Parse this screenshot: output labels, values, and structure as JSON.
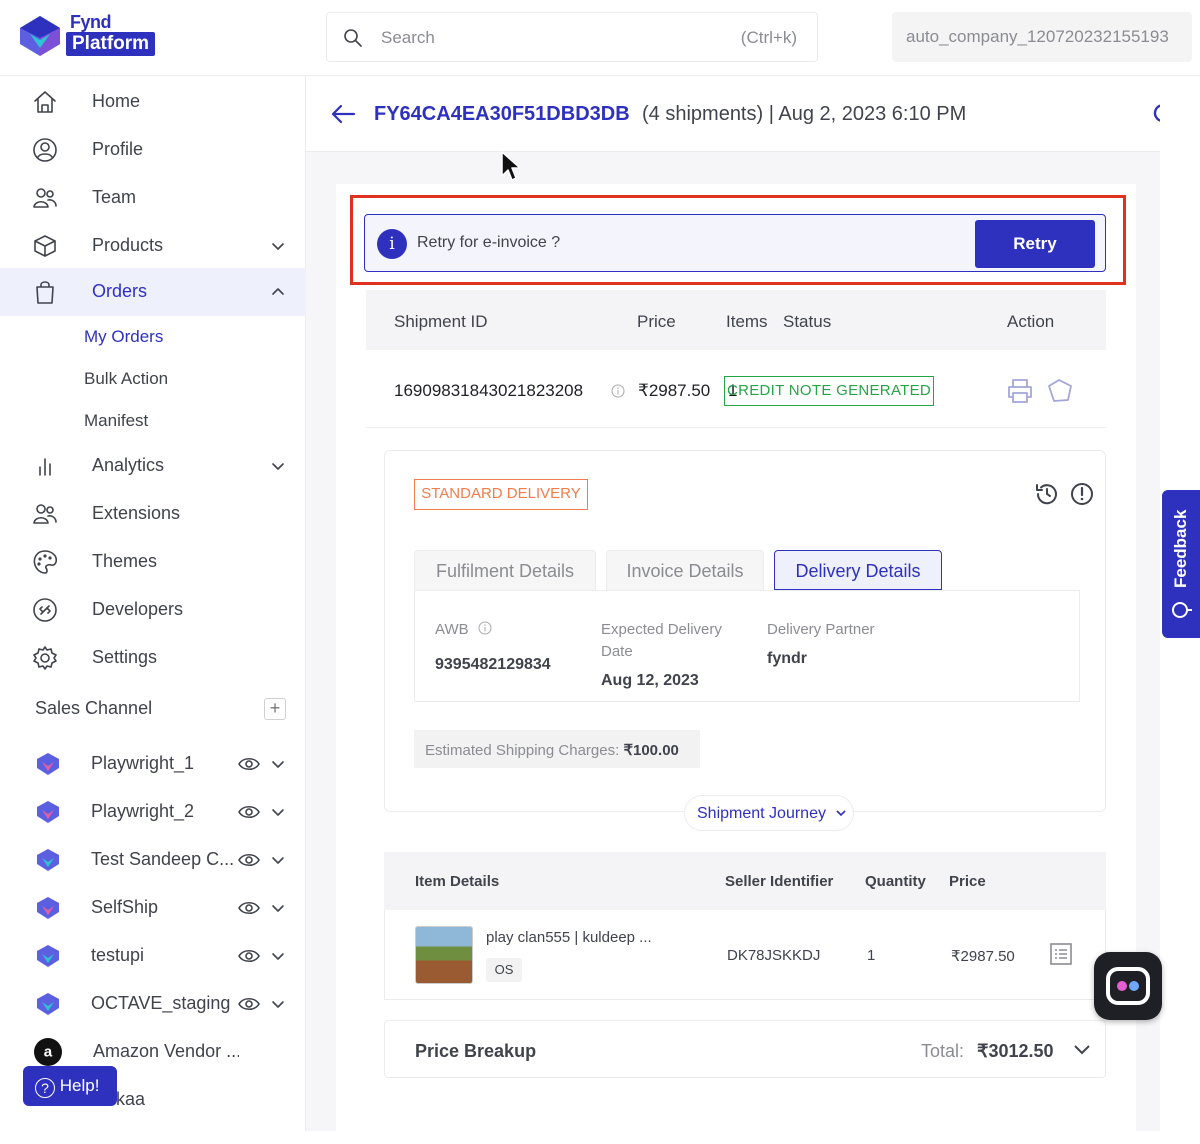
{
  "brand": {
    "line1": "Fynd",
    "line2": "Platform"
  },
  "search": {
    "placeholder": "Search",
    "shortcut": "(Ctrl+k)"
  },
  "company": "auto_company_120720232155193",
  "sidebar": {
    "items": [
      {
        "label": "Home",
        "icon": "home-icon"
      },
      {
        "label": "Profile",
        "icon": "profile-icon"
      },
      {
        "label": "Team",
        "icon": "team-icon"
      },
      {
        "label": "Products",
        "icon": "box-icon"
      },
      {
        "label": "Orders",
        "icon": "bag-icon"
      }
    ],
    "orders_sub": [
      "My Orders",
      "Bulk Action",
      "Manifest"
    ],
    "items2": [
      {
        "label": "Analytics",
        "icon": "analytics-icon"
      },
      {
        "label": "Extensions",
        "icon": "extensions-icon"
      },
      {
        "label": "Themes",
        "icon": "palette-icon"
      },
      {
        "label": "Developers",
        "icon": "developers-icon"
      },
      {
        "label": "Settings",
        "icon": "gear-icon"
      }
    ],
    "sales_channel_title": "Sales Channel",
    "channels": [
      "Playwright_1",
      "Playwright_2",
      "Test Sandeep C...",
      "SelfShip",
      "testupi",
      "OCTAVE_staging",
      "Amazon Vendor ...",
      "kaa"
    ],
    "help": "Help!"
  },
  "header": {
    "order_id": "FY64CA4EA30F51DBD3DB",
    "meta": "(4 shipments) | Aug 2, 2023 6:10 PM"
  },
  "alert": {
    "text": "Retry for e-invoice ?",
    "button": "Retry"
  },
  "shipment_table": {
    "headers": [
      "Shipment ID",
      "Price",
      "Items",
      "Status",
      "Action"
    ],
    "row": {
      "id": "16909831843021823208",
      "price": "₹2987.50",
      "items": "1",
      "status": "CREDIT NOTE GENERATED"
    }
  },
  "delivery_type": "STANDARD DELIVERY",
  "tabs": [
    "Fulfilment Details",
    "Invoice Details",
    "Delivery Details"
  ],
  "delivery": {
    "awb_label": "AWB",
    "awb": "9395482129834",
    "edd_label_1": "Expected Delivery",
    "edd_label_2": "Date",
    "edd": "Aug 12, 2023",
    "partner_label": "Delivery Partner",
    "partner": "fyndr"
  },
  "est_shipping": {
    "label": "Estimated Shipping Charges:",
    "value": "₹100.00"
  },
  "journey": "Shipment Journey",
  "items_table": {
    "headers": [
      "Item Details",
      "Seller Identifier",
      "Quantity",
      "Price"
    ],
    "row": {
      "name": "play clan555 | kuldeep ...",
      "size": "OS",
      "seller_id": "DK78JSKKDJ",
      "qty": "1",
      "price": "₹2987.50"
    }
  },
  "price_breakup": {
    "title": "Price Breakup",
    "total_label": "Total:",
    "total": "₹3012.50"
  },
  "feedback": "Feedback",
  "colors": {
    "brand": "#2e31be",
    "success": "#27a348",
    "warning": "#f07d4a",
    "highlight": "#e0301e"
  }
}
